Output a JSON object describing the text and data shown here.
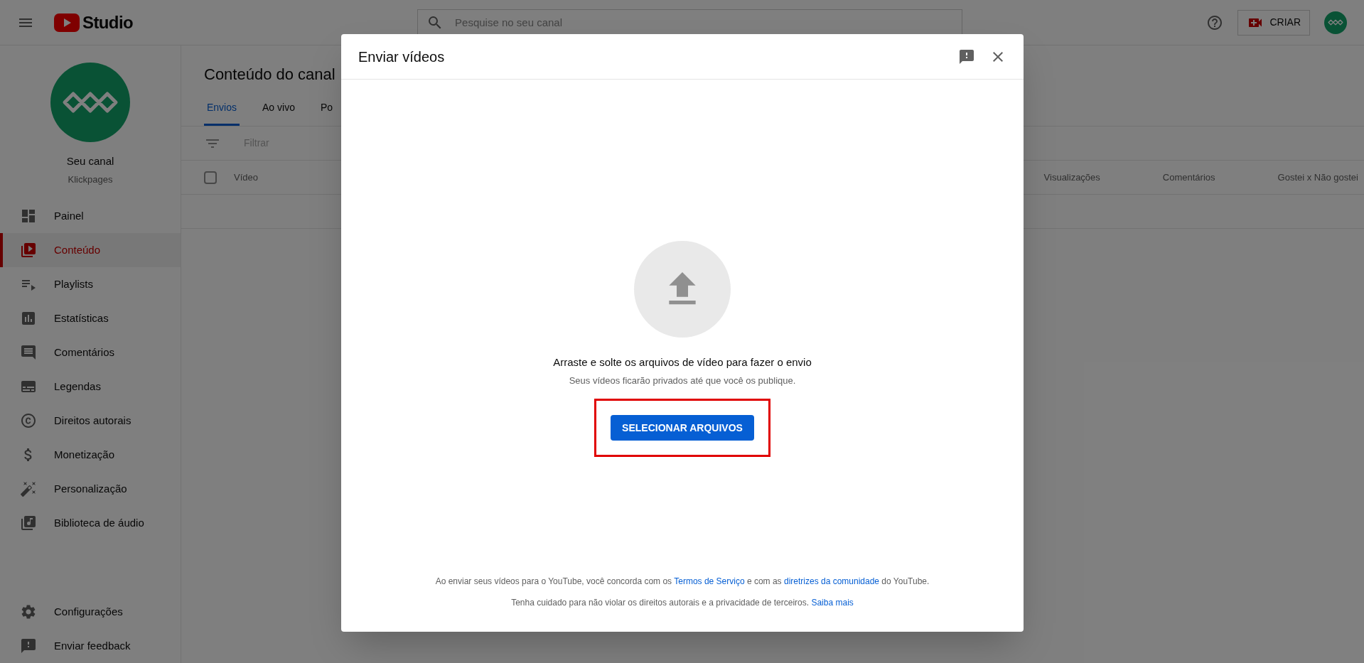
{
  "header": {
    "logo_text": "Studio",
    "search": {
      "placeholder": "Pesquise no seu canal"
    },
    "create_button": "CRIAR"
  },
  "sidebar": {
    "channel": {
      "title": "Seu canal",
      "name": "Klickpages"
    },
    "items": [
      {
        "label": "Painel",
        "selected": false
      },
      {
        "label": "Conteúdo",
        "selected": true
      },
      {
        "label": "Playlists",
        "selected": false
      },
      {
        "label": "Estatísticas",
        "selected": false
      },
      {
        "label": "Comentários",
        "selected": false
      },
      {
        "label": "Legendas",
        "selected": false
      },
      {
        "label": "Direitos autorais",
        "selected": false
      },
      {
        "label": "Monetização",
        "selected": false
      },
      {
        "label": "Personalização",
        "selected": false
      },
      {
        "label": "Biblioteca de áudio",
        "selected": false
      }
    ],
    "bottom_items": [
      {
        "label": "Configurações"
      },
      {
        "label": "Enviar feedback"
      }
    ]
  },
  "content": {
    "title": "Conteúdo do canal",
    "tabs": [
      {
        "label": "Envios",
        "selected": true
      },
      {
        "label": "Ao vivo",
        "selected": false
      },
      {
        "label": "Po",
        "selected": false
      }
    ],
    "filter": {
      "placeholder": "Filtrar"
    },
    "table": {
      "select_all_checked": false,
      "columns": [
        "Vídeo",
        "Visualizações",
        "Comentários",
        "Gostei x Não gostei"
      ]
    }
  },
  "dialog": {
    "title": "Enviar vídeos",
    "drop_text": "Arraste e solte os arquivos de vídeo para fazer o envio",
    "note": "Seus vídeos ficarão privados até que você os publique.",
    "upload_button": {
      "label": "SELECIONAR ARQUIVOS",
      "highlighted": true
    },
    "footer": [
      [
        {
          "text": "Ao enviar seus vídeos para o YouTube, você concorda com os ",
          "link": false
        },
        {
          "text": "Termos de Serviço",
          "link": true
        },
        {
          "text": " e com as ",
          "link": false
        },
        {
          "text": "diretrizes da comunidade",
          "link": true
        },
        {
          "text": " do YouTube.",
          "link": false
        }
      ],
      [
        {
          "text": "Tenha cuidado para não violar os direitos autorais e a privacidade de terceiros. ",
          "link": false
        },
        {
          "text": "Saiba mais",
          "link": true
        }
      ]
    ]
  }
}
